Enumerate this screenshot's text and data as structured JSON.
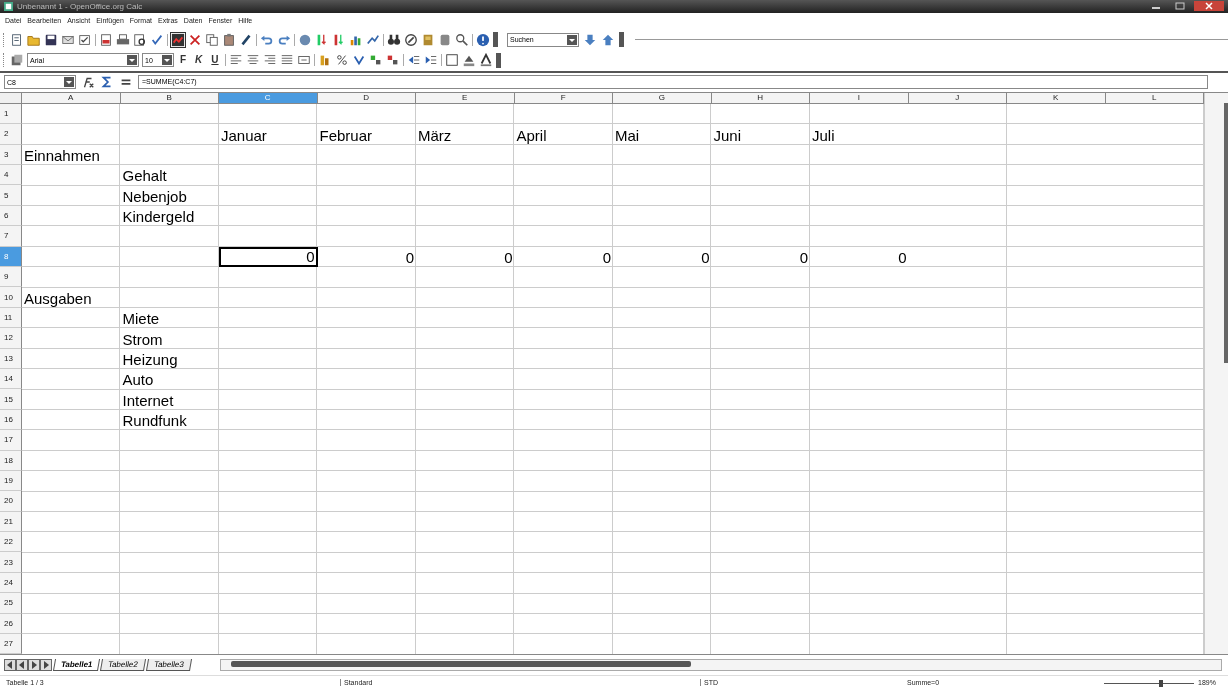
{
  "window": {
    "title": "Unbenannt 1 - OpenOffice.org Calc"
  },
  "menu": [
    "Datei",
    "Bearbeiten",
    "Ansicht",
    "Einfügen",
    "Format",
    "Extras",
    "Daten",
    "Fenster",
    "Hilfe"
  ],
  "find_toolbar": {
    "value": "Suchen"
  },
  "formatting": {
    "font": "Arial",
    "size": "10",
    "style_buttons": [
      "F",
      "K",
      "U"
    ]
  },
  "formula_bar": {
    "cell_reference": "C8",
    "formula": "=SUMME(C4:C7)"
  },
  "columns": [
    {
      "label": "A",
      "selected": false
    },
    {
      "label": "B",
      "selected": false
    },
    {
      "label": "C",
      "selected": true
    },
    {
      "label": "D",
      "selected": false
    },
    {
      "label": "E",
      "selected": false
    },
    {
      "label": "F",
      "selected": false
    },
    {
      "label": "G",
      "selected": false
    },
    {
      "label": "H",
      "selected": false
    },
    {
      "label": "I",
      "selected": false
    },
    {
      "label": "J",
      "selected": false
    },
    {
      "label": "K",
      "selected": false
    },
    {
      "label": "L",
      "selected": false
    }
  ],
  "rows": [
    {
      "label": "1",
      "selected": false
    },
    {
      "label": "2",
      "selected": false,
      "cells": {
        "C": {
          "text": "Januar",
          "kind": "text",
          "selected": false
        },
        "D": {
          "text": "Februar",
          "kind": "text",
          "selected": false
        },
        "E": {
          "text": "März",
          "kind": "text",
          "selected": false
        },
        "F": {
          "text": "April",
          "kind": "text",
          "selected": false
        },
        "G": {
          "text": "Mai",
          "kind": "text",
          "selected": false
        },
        "H": {
          "text": "Juni",
          "kind": "text",
          "selected": false
        },
        "I": {
          "text": "Juli",
          "kind": "text",
          "selected": false
        }
      }
    },
    {
      "label": "3",
      "selected": false,
      "cells": {
        "A": {
          "text": "Einnahmen",
          "kind": "text",
          "selected": false
        }
      }
    },
    {
      "label": "4",
      "selected": false,
      "cells": {
        "B": {
          "text": "Gehalt",
          "kind": "text",
          "selected": false
        }
      }
    },
    {
      "label": "5",
      "selected": false,
      "cells": {
        "B": {
          "text": "Nebenjob",
          "kind": "text",
          "selected": false
        }
      }
    },
    {
      "label": "6",
      "selected": false,
      "cells": {
        "B": {
          "text": "Kindergeld",
          "kind": "text",
          "selected": false
        }
      }
    },
    {
      "label": "7",
      "selected": false
    },
    {
      "label": "8",
      "selected": true,
      "cells": {
        "C": {
          "text": "0",
          "kind": "number",
          "selected": true
        },
        "D": {
          "text": "0",
          "kind": "number",
          "selected": false
        },
        "E": {
          "text": "0",
          "kind": "number",
          "selected": false
        },
        "F": {
          "text": "0",
          "kind": "number",
          "selected": false
        },
        "G": {
          "text": "0",
          "kind": "number",
          "selected": false
        },
        "H": {
          "text": "0",
          "kind": "number",
          "selected": false
        },
        "I": {
          "text": "0",
          "kind": "number",
          "selected": false
        }
      }
    },
    {
      "label": "9",
      "selected": false
    },
    {
      "label": "10",
      "selected": false,
      "cells": {
        "A": {
          "text": "Ausgaben",
          "kind": "text",
          "selected": false
        }
      }
    },
    {
      "label": "11",
      "selected": false,
      "cells": {
        "B": {
          "text": "Miete",
          "kind": "text",
          "selected": false
        }
      }
    },
    {
      "label": "12",
      "selected": false,
      "cells": {
        "B": {
          "text": "Strom",
          "kind": "text",
          "selected": false
        }
      }
    },
    {
      "label": "13",
      "selected": false,
      "cells": {
        "B": {
          "text": "Heizung",
          "kind": "text",
          "selected": false
        }
      }
    },
    {
      "label": "14",
      "selected": false,
      "cells": {
        "B": {
          "text": "Auto",
          "kind": "text",
          "selected": false
        }
      }
    },
    {
      "label": "15",
      "selected": false,
      "cells": {
        "B": {
          "text": "Internet",
          "kind": "text",
          "selected": false
        }
      }
    },
    {
      "label": "16",
      "selected": false,
      "cells": {
        "B": {
          "text": "Rundfunk",
          "kind": "text",
          "selected": false
        }
      }
    },
    {
      "label": "17",
      "selected": false
    },
    {
      "label": "18",
      "selected": false
    },
    {
      "label": "19",
      "selected": false
    },
    {
      "label": "20",
      "selected": false
    },
    {
      "label": "21",
      "selected": false
    },
    {
      "label": "22",
      "selected": false
    },
    {
      "label": "23",
      "selected": false
    },
    {
      "label": "24",
      "selected": false
    },
    {
      "label": "25",
      "selected": false
    },
    {
      "label": "26",
      "selected": false
    },
    {
      "label": "27",
      "selected": false
    }
  ],
  "sheet_tabs": [
    {
      "label": "Tabelle1",
      "selected": true
    },
    {
      "label": "Tabelle2",
      "selected": false
    },
    {
      "label": "Tabelle3",
      "selected": false
    }
  ],
  "status_bar": {
    "sheet": "Tabelle 1 / 3",
    "style": "Standard",
    "mode": "STD",
    "sum": "Summe=0",
    "zoom": "189%",
    "zoom_slider": {
      "level": 0.63
    }
  }
}
